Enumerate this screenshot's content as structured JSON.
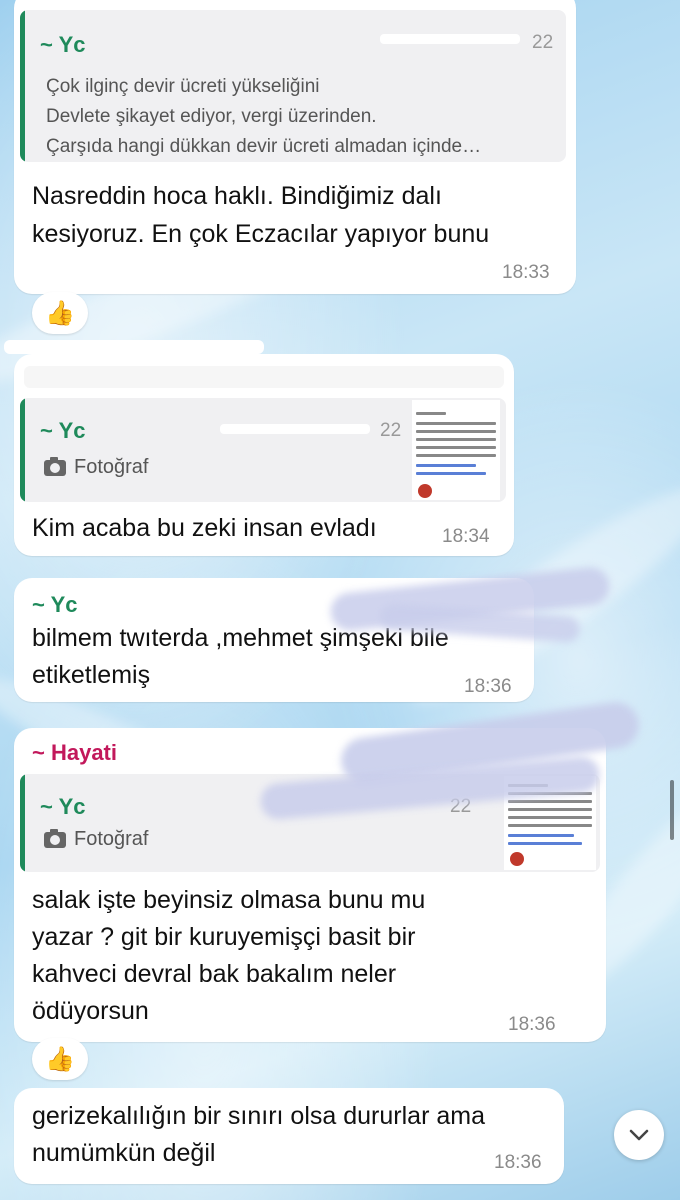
{
  "messages": [
    {
      "quote": {
        "name": "~ Yc",
        "lines": [
          "Çok ilginç devir ücreti yükseliğini",
          "Devlete şikayet ediyor, vergi üzerinden.",
          "Çarşıda hangi dükkan devir ücreti almadan içinde…"
        ]
      },
      "lines": [
        "Nasreddin hoca haklı. Bindiğimiz dalı",
        "kesiyoruz. En çok Eczacılar yapıyor bunu"
      ],
      "time": "18:33",
      "reaction": "👍"
    },
    {
      "quote": {
        "name": "~ Yc",
        "photo_label": "Fotoğraf",
        "partial_time": "22"
      },
      "lines": [
        "Kim acaba bu zeki insan evladı"
      ],
      "time": "18:34"
    },
    {
      "sender": "~ Yc",
      "lines": [
        "bilmem twıterda ,mehmet şimşeki bile",
        "etiketlemiş"
      ],
      "time": "18:36"
    },
    {
      "sender": "~ Hayati",
      "quote": {
        "name": "~ Yc",
        "photo_label": "Fotoğraf",
        "partial_time": "22"
      },
      "lines": [
        "salak işte beyinsiz olmasa bunu mu",
        "yazar ? git bir kuruyemişçi basit bir",
        "kahveci devral bak bakalım neler",
        "ödüyorsun"
      ],
      "time": "18:36",
      "reaction": "👍"
    },
    {
      "lines": [
        "gerizekalılığın bir sınırı olsa dururlar ama",
        "numümkün değil"
      ],
      "time": "18:36"
    }
  ],
  "top_partial_time": "22",
  "colors": {
    "yc": "#1f8a5b",
    "hayati": "#c2185b"
  },
  "icons": {
    "photo": "camera-icon",
    "reaction": "thumbs-up",
    "scroll": "chevron-down-icon"
  }
}
